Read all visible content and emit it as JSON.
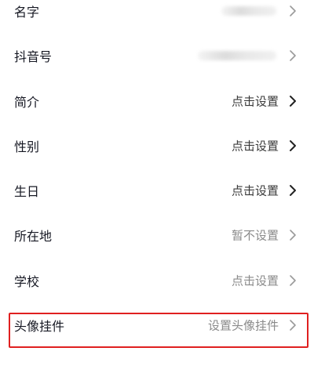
{
  "profile_edit": {
    "rows": [
      {
        "label": "名字",
        "value": "",
        "value_hidden": true
      },
      {
        "label": "抖音号",
        "value": "",
        "value_hidden": true
      },
      {
        "label": "简介",
        "value": "点击设置"
      },
      {
        "label": "性别",
        "value": "点击设置"
      },
      {
        "label": "生日",
        "value": "点击设置"
      },
      {
        "label": "所在地",
        "value": "暂不设置"
      },
      {
        "label": "学校",
        "value": "点击设置"
      },
      {
        "label": "头像挂件",
        "value": "设置头像挂件",
        "highlighted": true
      }
    ],
    "chevron_icon": "chevron-right-icon",
    "highlight_color": "#e02020"
  }
}
